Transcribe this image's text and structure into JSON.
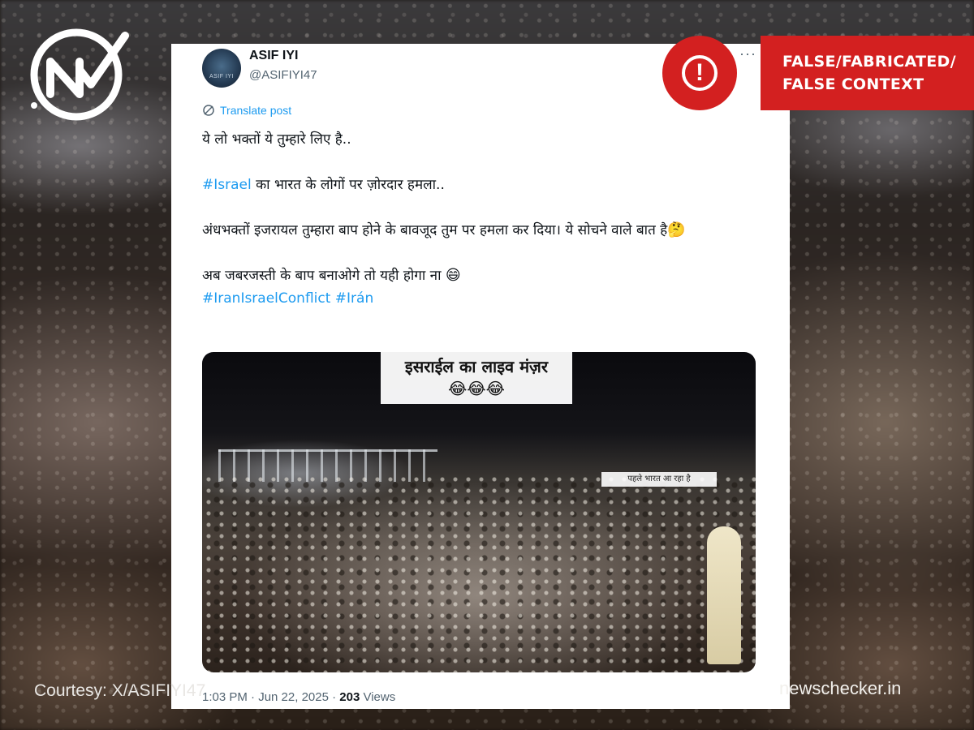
{
  "tweet": {
    "author_name": "ASIF IYI",
    "author_handle": "@ASIFIYI47",
    "avatar_text": "ASIF IYI",
    "translate_label": "Translate post",
    "line1": "ये लो भक्तों ये तुम्हारे लिए है..",
    "line2_hashtag": "#Israel",
    "line2_rest": " का भारत के लोगों पर ज़ोरदार हमला..",
    "line3": "अंधभक्तों इजरायल तुम्हारा बाप होने के बावजूद तुम पर हमला कर दिया। ये सोचने वाले बात है",
    "line3_emoji": "🤔",
    "line4": "अब जबरजस्ती के बाप बनाओगे तो यही होगा ना ",
    "line4_emoji": "😄",
    "hashtag_a": "#IranIsraelConflict",
    "hashtag_b": "#Irán",
    "media_caption": "इसराईल का लाइव मंज़र",
    "media_caption_emoji": "😂😂😂",
    "media_subcaption": "पहले भारत आ रहा है",
    "time": "1:03 PM · Jun 22, 2025 · ",
    "views_count": "203",
    "views_label": " Views"
  },
  "verdict": {
    "line1": "FALSE/FABRICATED/",
    "line2": "FALSE CONTEXT",
    "color": "#d32020"
  },
  "footer": {
    "courtesy": "Courtesy: X/ASIFIYI47",
    "site": "newschecker.in"
  },
  "colors": {
    "link": "#1d9bf0",
    "alert": "#d32020"
  }
}
